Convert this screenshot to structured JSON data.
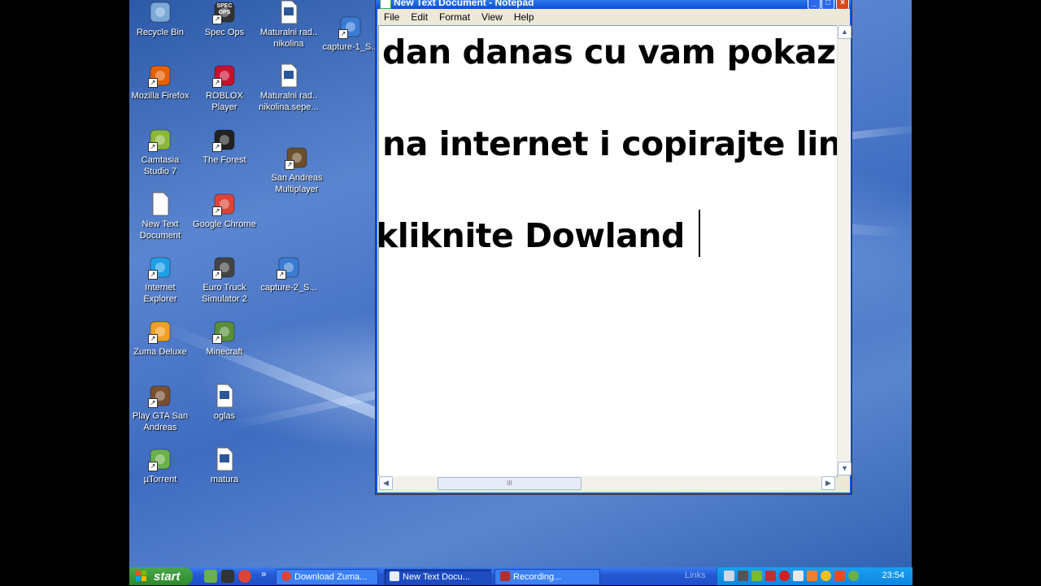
{
  "desktop": {
    "icons": [
      {
        "label": "Recycle Bin",
        "icon": "recycle-bin-icon",
        "color": "#7aa8d8"
      },
      {
        "label": "Spec Ops",
        "icon": "spec-ops-icon",
        "color": "#333333",
        "badge": "SPEC OPS"
      },
      {
        "label": "Maturalni rad.. nikolina",
        "icon": "word-document-icon",
        "color": "#2b5797"
      },
      {
        "label": "capture-1_S...",
        "icon": "camtasia-capture-icon",
        "color": "#3a7bd5"
      },
      {
        "label": "Mozilla Firefox",
        "icon": "firefox-icon",
        "color": "#e66000"
      },
      {
        "label": "ROBLOX Player",
        "icon": "roblox-icon",
        "color": "#c8102e"
      },
      {
        "label": "Maturalni rad.. nikolina.sepe...",
        "icon": "word-document-icon",
        "color": "#2b5797"
      },
      {
        "label": "Camtasia Studio 7",
        "icon": "camtasia-icon",
        "color": "#8bb83a"
      },
      {
        "label": "The Forest",
        "icon": "the-forest-icon",
        "color": "#222222"
      },
      {
        "label": "San Andreas Multiplayer",
        "icon": "san-andreas-multiplayer-icon",
        "color": "#6b4f2a"
      },
      {
        "label": "New Text Document",
        "icon": "text-document-icon",
        "color": "#ffffff"
      },
      {
        "label": "Google Chrome",
        "icon": "chrome-icon",
        "color": "#db4437"
      },
      {
        "label": "Internet Explorer",
        "icon": "internet-explorer-icon",
        "color": "#1ea0e8"
      },
      {
        "label": "Euro Truck Simulator 2",
        "icon": "euro-truck-icon",
        "color": "#444444"
      },
      {
        "label": "capture-2_S...",
        "icon": "camtasia-capture-icon",
        "color": "#3a7bd5"
      },
      {
        "label": "Zuma Deluxe",
        "icon": "zuma-icon",
        "color": "#f0a020"
      },
      {
        "label": "Minecraft",
        "icon": "minecraft-icon",
        "color": "#5a8f3a"
      },
      {
        "label": "Play GTA San Andreas",
        "icon": "gta-san-andreas-icon",
        "color": "#7a5030"
      },
      {
        "label": "oglas",
        "icon": "word-document-icon",
        "color": "#2b5797"
      },
      {
        "label": "µTorrent",
        "icon": "utorrent-icon",
        "color": "#6ab04c"
      },
      {
        "label": "matura",
        "icon": "word-document-icon",
        "color": "#2b5797"
      }
    ]
  },
  "notepad": {
    "title": "New Text Document - Notepad",
    "menu": [
      "File",
      "Edit",
      "Format",
      "View",
      "Help"
    ],
    "lines": [
      "dan danas cu vam pokaz",
      "na internet i copirajte lin",
      "kliknite Dowland"
    ],
    "hscroll_thumb": "III"
  },
  "taskbar": {
    "start_label": "start",
    "tasks": [
      "Download Zuma...",
      "New Text Docu...",
      "Recording..."
    ],
    "links_label": "Links",
    "clock": "23:54",
    "more": "»"
  }
}
